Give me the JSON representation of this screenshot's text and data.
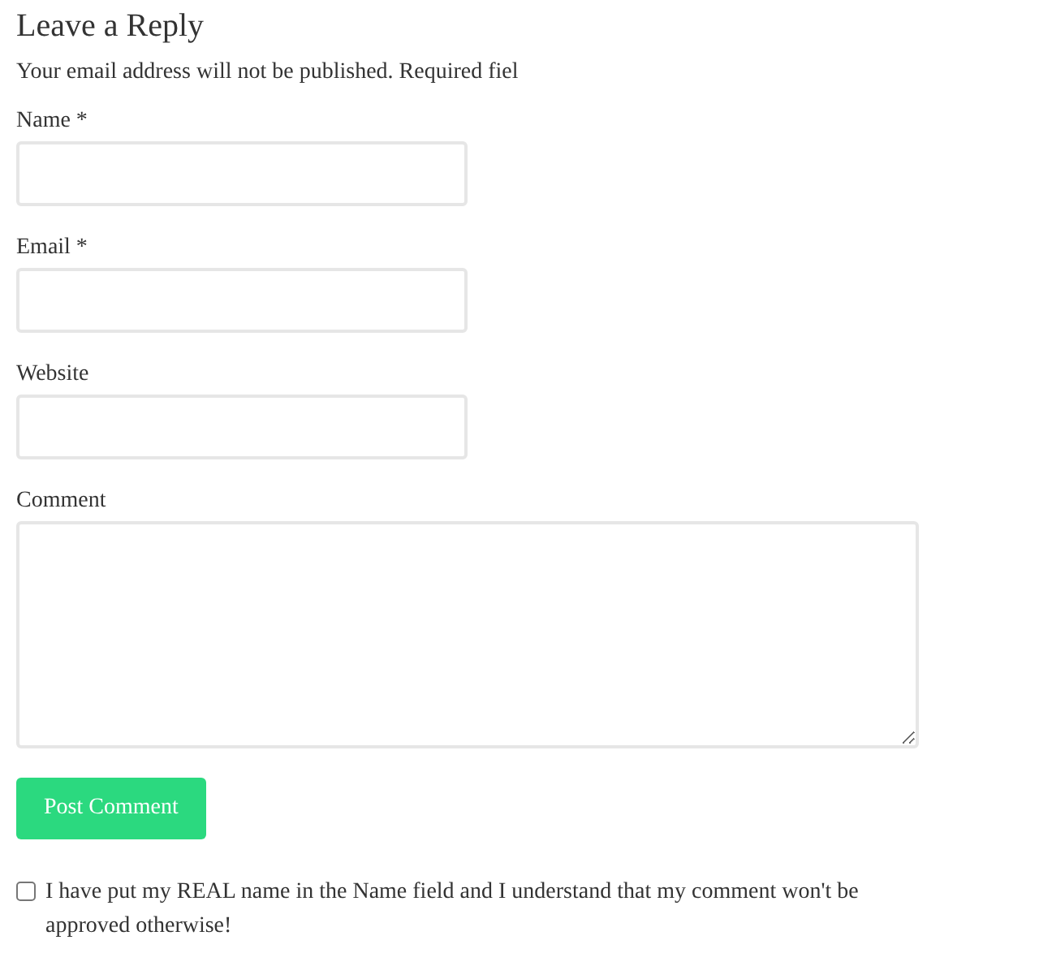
{
  "heading": "Leave a Reply",
  "notice": "Your email address will not be published. Required fiel",
  "fields": [
    {
      "label": "Name *",
      "kind": "text"
    },
    {
      "label": "Email *",
      "kind": "text"
    },
    {
      "label": "Website",
      "kind": "text"
    },
    {
      "label": "Comment",
      "kind": "textarea"
    }
  ],
  "submit_button": "Post Comment",
  "consent": {
    "checked": false,
    "label": "I have put my REAL name in the Name field and I understand that my comment won't be approved otherwise!"
  }
}
